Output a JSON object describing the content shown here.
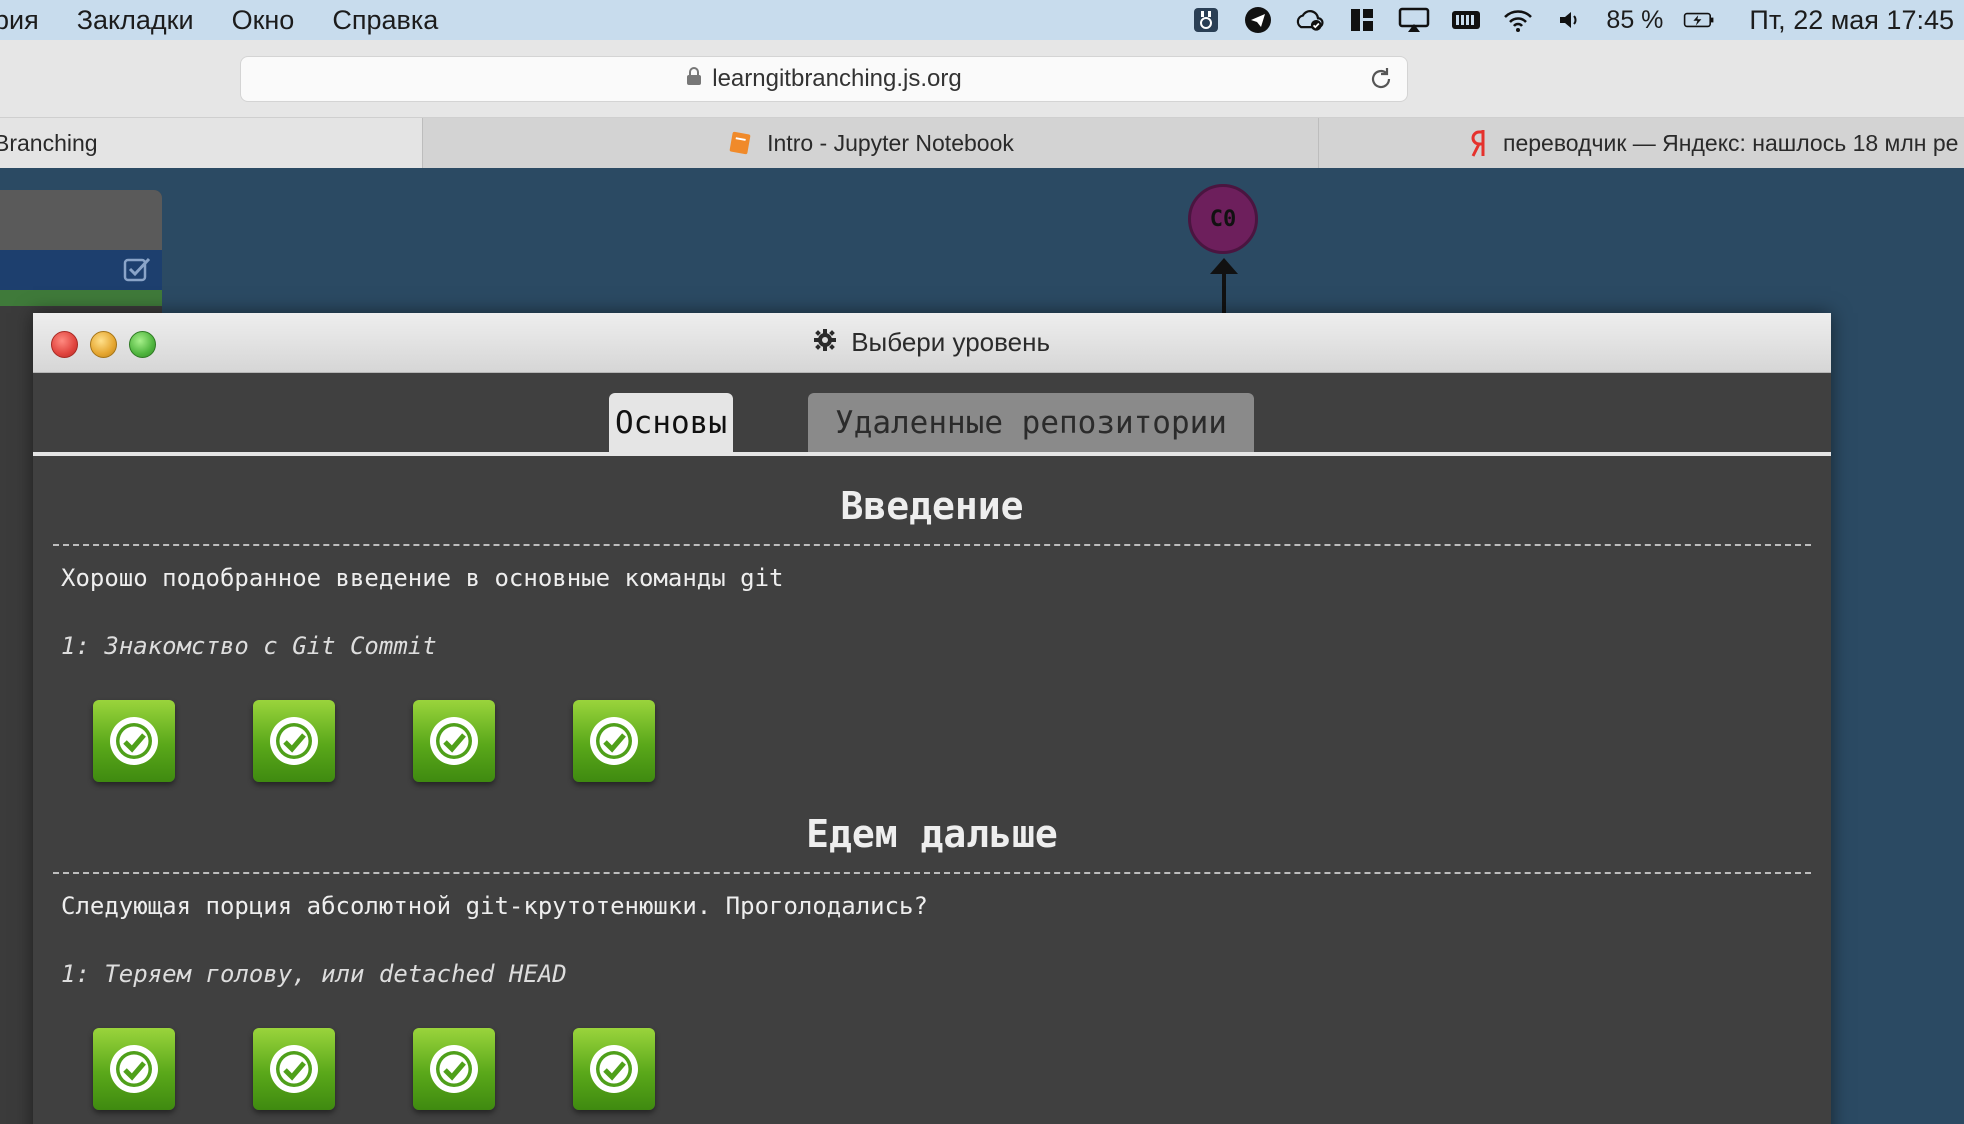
{
  "menubar": {
    "items": [
      "рия",
      "Закладки",
      "Окно",
      "Справка"
    ],
    "battery": "85 %",
    "datetime": "Пт, 22 мая  17:45"
  },
  "browser": {
    "url": "learngitbranching.js.org",
    "tabs": [
      {
        "label": "Branching"
      },
      {
        "label": "Intro - Jupyter Notebook",
        "icon": "notebook-icon"
      },
      {
        "label": "переводчик — Яндекс: нашлось 18 млн ре",
        "icon": "yandex-icon"
      }
    ]
  },
  "graph": {
    "commit_label": "C0"
  },
  "modal": {
    "title": "Выбери уровень",
    "tabs": [
      "Основы",
      "Удаленные репозитории"
    ],
    "sections": [
      {
        "title": "Введение",
        "description": "Хорошо подобранное введение в основные команды git",
        "sequence": "1: Знакомство с Git Commit",
        "levels_completed": 4
      },
      {
        "title": "Едем дальше",
        "description": "Следующая порция абсолютной git-крутотенюшки. Проголодались?",
        "sequence": "1: Теряем голову, или detached HEAD",
        "levels_completed": 4
      }
    ]
  },
  "colors": {
    "background": "#2b4a63",
    "modal": "#404040",
    "level_complete": "#5aa81a",
    "commit_node": "#6d1f5c"
  }
}
